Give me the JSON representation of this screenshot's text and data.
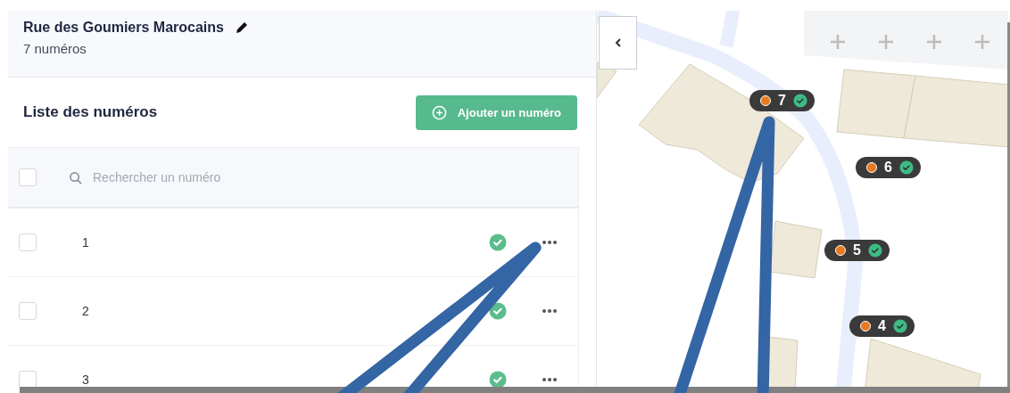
{
  "street": {
    "name": "Rue des Goumiers Marocains",
    "count": "7 numéros"
  },
  "list": {
    "title": "Liste des numéros",
    "add_button": "Ajouter un numéro",
    "select_all": {
      "checked": false
    },
    "search": {
      "placeholder": "Rechercher un numéro"
    },
    "rows": [
      {
        "number": "1",
        "checked": false,
        "validated": true
      },
      {
        "number": "2",
        "checked": false,
        "validated": true
      },
      {
        "number": "3",
        "checked": false,
        "validated": true
      }
    ]
  },
  "map": {
    "markers": [
      {
        "number": "7",
        "validated": true
      },
      {
        "number": "6",
        "validated": true
      },
      {
        "number": "5",
        "validated": true
      },
      {
        "number": "4",
        "validated": true
      }
    ]
  }
}
